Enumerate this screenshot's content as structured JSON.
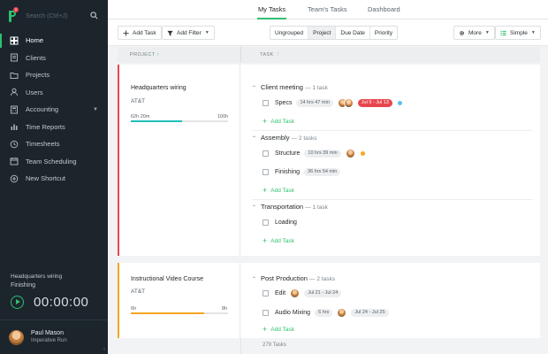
{
  "sidebar": {
    "logo_badge": "0",
    "search_placeholder": "Search (Ctrl+J)",
    "items": [
      {
        "label": "Home",
        "icon": "home-icon",
        "active": true
      },
      {
        "label": "Clients",
        "icon": "clients-icon"
      },
      {
        "label": "Projects",
        "icon": "projects-icon"
      },
      {
        "label": "Users",
        "icon": "users-icon"
      },
      {
        "label": "Accounting",
        "icon": "accounting-icon",
        "has_caret": true
      },
      {
        "label": "Time Reports",
        "icon": "time-reports-icon"
      },
      {
        "label": "Timesheets",
        "icon": "timesheets-icon"
      },
      {
        "label": "Team Scheduling",
        "icon": "team-scheduling-icon"
      },
      {
        "label": "New Shortcut",
        "icon": "plus-circle-icon"
      }
    ],
    "timer": {
      "project": "Headquarters wiring",
      "task": "Finishing",
      "value": "00:00:00"
    },
    "user": {
      "name": "Paul Mason",
      "company": "Imperative Run"
    }
  },
  "tabs": [
    "My Tasks",
    "Team's Tasks",
    "Dashboard"
  ],
  "toolbar": {
    "add_task": "Add Task",
    "add_filter": "Add Filter",
    "groupings": [
      "Ungrouped",
      "Project",
      "Due Date",
      "Priority"
    ],
    "selected_grouping": "Project",
    "more": "More",
    "view": "Simple"
  },
  "columns": {
    "project": "PROJECT",
    "task": "TASK"
  },
  "projects": [
    {
      "name": "Headquarters wiring",
      "client": "AT&T",
      "accent": "#e8464e",
      "progress": {
        "done": "62h 20m",
        "total": "100h",
        "fill_color": "#1fbfb8",
        "fraction": 0.53
      },
      "groups": [
        {
          "title": "Client meeting",
          "count": "— 1 task",
          "tasks": [
            {
              "name": "Specs",
              "estimate": "14 hrs 47 min",
              "date": "Jul 9 - Jul 13",
              "dot": "#5bc0eb"
            }
          ],
          "add": "Add Task"
        },
        {
          "title": "Assembly",
          "count": "— 2 tasks",
          "tasks": [
            {
              "name": "Structure",
              "estimate": "10 hrs 39 min",
              "dot": "#f5a623"
            },
            {
              "name": "Finishing",
              "estimate": "36 hrs 54 min"
            }
          ],
          "add": "Add Task"
        },
        {
          "title": "Transportation",
          "count": "— 1 task",
          "tasks": [
            {
              "name": "Loading"
            }
          ],
          "add": "Add Task"
        }
      ]
    },
    {
      "name": "Instructional Video Course",
      "client": "AT&T",
      "accent": "#f5a623",
      "progress": {
        "done": "6h",
        "total": "8h",
        "fill_color": "#f5a623",
        "fraction": 0.75
      },
      "groups": [
        {
          "title": "Post Production",
          "count": "— 2 tasks",
          "tasks": [
            {
              "name": "Edit",
              "date": "Jul 21 - Jul 24"
            },
            {
              "name": "Audio Mixing",
              "estimate": "6 hrs",
              "date": "Jul 24 - Jul 25"
            }
          ],
          "add": "Add Task"
        }
      ]
    }
  ],
  "footer": {
    "task_count": "279 Tasks"
  }
}
